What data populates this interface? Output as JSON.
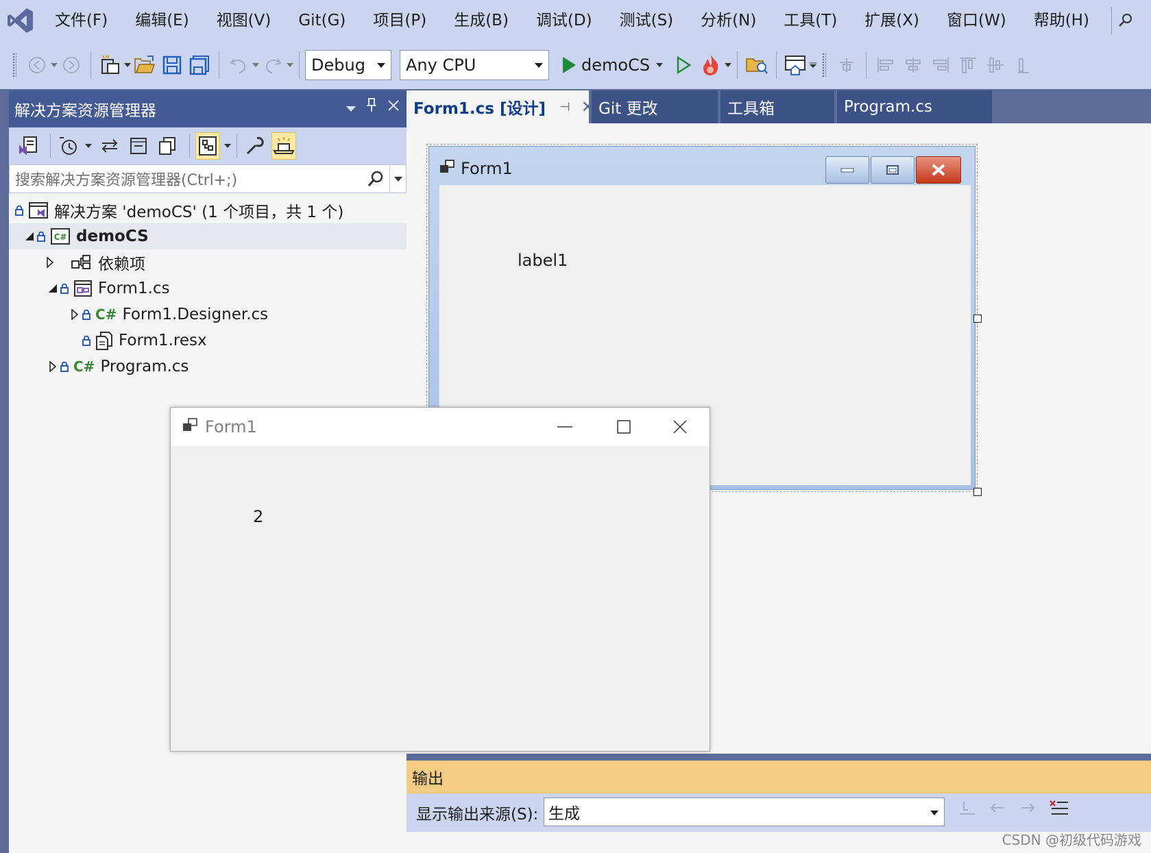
{
  "menubar": {
    "items": [
      "文件(F)",
      "编辑(E)",
      "视图(V)",
      "Git(G)",
      "项目(P)",
      "生成(B)",
      "调试(D)",
      "测试(S)",
      "分析(N)",
      "工具(T)",
      "扩展(X)",
      "窗口(W)",
      "帮助(H)"
    ]
  },
  "toolbar": {
    "config": "Debug",
    "platform": "Any CPU",
    "run_target": "demoCS"
  },
  "solution_explorer": {
    "title": "解决方案资源管理器",
    "search_placeholder": "搜索解决方案资源管理器(Ctrl+;)",
    "solution": "解决方案 'demoCS' (1 个项目，共 1 个)",
    "project": "demoCS",
    "items": {
      "dependencies": "依赖项",
      "form1": "Form1.cs",
      "form1_designer": "Form1.Designer.cs",
      "form1_resx": "Form1.resx",
      "program": "Program.cs"
    }
  },
  "tabs": {
    "active": "Form1.cs [设计]",
    "git": "Git 更改",
    "toolbox": "工具箱",
    "program": "Program.cs"
  },
  "design_form": {
    "title": "Form1",
    "label": "label1"
  },
  "running_form": {
    "title": "Form1",
    "label": "2"
  },
  "output": {
    "title": "输出",
    "source_label": "显示输出来源(S):",
    "source_value": "生成"
  },
  "watermark": "CSDN @初级代码游戏",
  "colors": {
    "accent": "#445a94",
    "output_header": "#f5cc84",
    "run_green": "#1e8a3a"
  }
}
